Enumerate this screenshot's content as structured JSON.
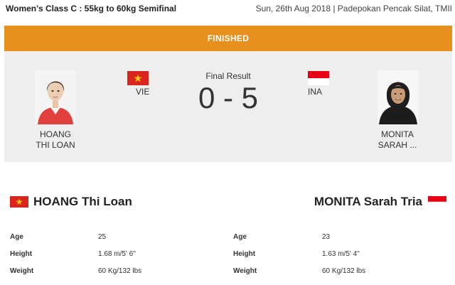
{
  "event": {
    "title": "Women's Class C : 55kg to 60kg Semifinal",
    "meta": "Sun, 26th Aug 2018 | Padepokan Pencak Silat, TMII"
  },
  "status": "FINISHED",
  "match": {
    "result_label": "Final Result",
    "score": "0 - 5",
    "athlete_a": {
      "short_line1": "HOANG",
      "short_line2": "THI LOAN",
      "country": "VIE"
    },
    "athlete_b": {
      "short_line1": "MONITA",
      "short_line2": "SARAH ...",
      "country": "INA"
    }
  },
  "profiles": {
    "a": {
      "name": "HOANG Thi Loan",
      "stats": [
        {
          "label": "Age",
          "value": "25"
        },
        {
          "label": "Height",
          "value": "1.68 m/5' 6\""
        },
        {
          "label": "Weight",
          "value": "60 Kg/132 lbs"
        }
      ]
    },
    "b": {
      "name": "MONITA Sarah Tria",
      "stats": [
        {
          "label": "Age",
          "value": "23"
        },
        {
          "label": "Height",
          "value": "1.63 m/5' 4\""
        },
        {
          "label": "Weight",
          "value": "60 Kg/132 lbs"
        }
      ]
    }
  },
  "colors": {
    "status_bar": "#e8901e",
    "vie_red": "#da251d",
    "vie_star": "#ffcd00",
    "ina_red": "#e70011"
  }
}
